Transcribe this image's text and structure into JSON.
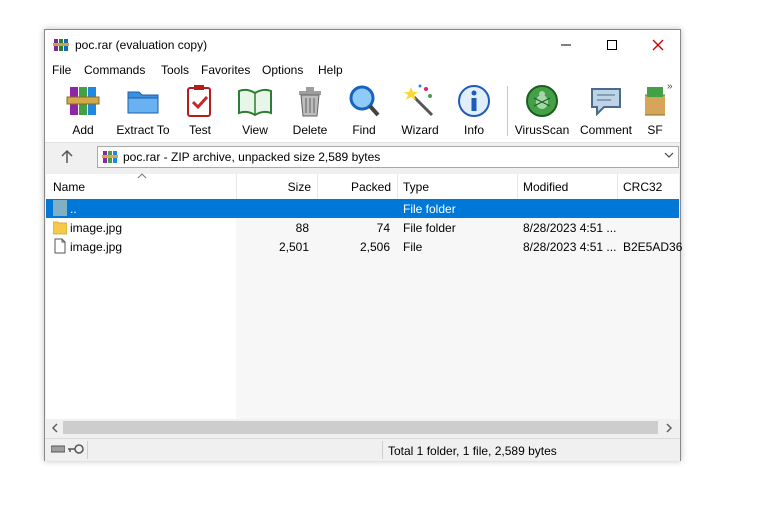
{
  "window": {
    "title": "poc.rar (evaluation copy)"
  },
  "menu": [
    "File",
    "Commands",
    "Tools",
    "Favorites",
    "Options",
    "Help"
  ],
  "toolbar": [
    {
      "label": "Add",
      "icon": "add-icon"
    },
    {
      "label": "Extract To",
      "icon": "extract-to-icon"
    },
    {
      "label": "Test",
      "icon": "test-icon"
    },
    {
      "label": "View",
      "icon": "view-icon"
    },
    {
      "label": "Delete",
      "icon": "delete-icon"
    },
    {
      "label": "Find",
      "icon": "find-icon"
    },
    {
      "label": "Wizard",
      "icon": "wizard-icon"
    },
    {
      "label": "Info",
      "icon": "info-icon"
    },
    {
      "label": "VirusScan",
      "icon": "virusscan-icon"
    },
    {
      "label": "Comment",
      "icon": "comment-icon"
    },
    {
      "label": "SF",
      "icon": "sfx-icon"
    }
  ],
  "address": {
    "text": "poc.rar - ZIP archive, unpacked size 2,589 bytes"
  },
  "columns": {
    "name": "Name",
    "size": "Size",
    "packed": "Packed",
    "type": "Type",
    "modified": "Modified",
    "crc": "CRC32"
  },
  "rows": [
    {
      "name": "..",
      "size": "",
      "packed": "",
      "type": "File folder",
      "modified": "",
      "crc": "",
      "icon": "parent-folder-icon",
      "selected": true
    },
    {
      "name": "image.jpg",
      "size": "88",
      "packed": "74",
      "type": "File folder",
      "modified": "8/28/2023 4:51 ...",
      "crc": "",
      "icon": "folder-icon",
      "selected": false
    },
    {
      "name": "image.jpg",
      "size": "2,501",
      "packed": "2,506",
      "type": "File",
      "modified": "8/28/2023 4:51 ...",
      "crc": "B2E5AD36",
      "icon": "file-icon",
      "selected": false
    }
  ],
  "status": {
    "text": "Total 1 folder, 1 file, 2,589 bytes"
  },
  "colors": {
    "selection": "#0078d7",
    "window_bg": "#f0f0f0"
  }
}
